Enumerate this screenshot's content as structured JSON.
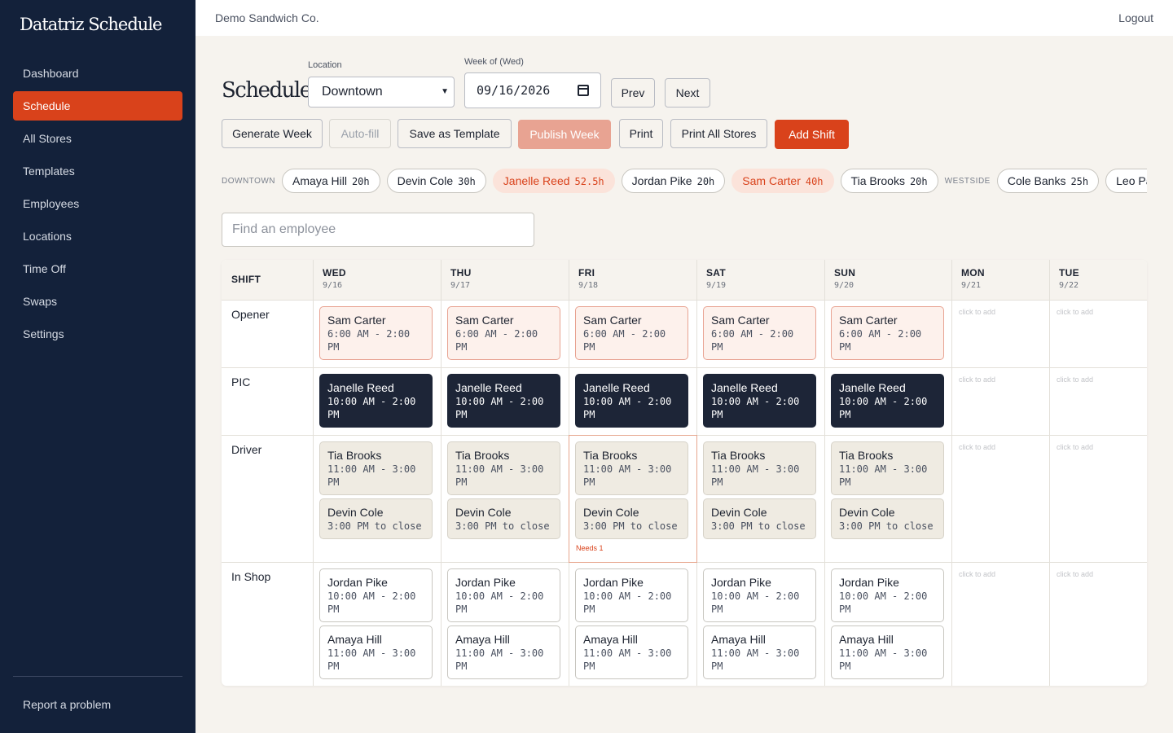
{
  "app": {
    "brand": "Datatriz Schedule",
    "company": "Demo Sandwich Co.",
    "logout": "Logout"
  },
  "sidebar": {
    "items": [
      {
        "label": "Dashboard",
        "active": false
      },
      {
        "label": "Schedule",
        "active": true
      },
      {
        "label": "All Stores",
        "active": false
      },
      {
        "label": "Templates",
        "active": false
      },
      {
        "label": "Employees",
        "active": false
      },
      {
        "label": "Locations",
        "active": false
      },
      {
        "label": "Time Off",
        "active": false
      },
      {
        "label": "Swaps",
        "active": false
      },
      {
        "label": "Settings",
        "active": false
      }
    ],
    "report": "Report a problem"
  },
  "controls": {
    "title": "Schedule",
    "location_label": "Location",
    "location_value": "Downtown",
    "week_label": "Week of (Wed)",
    "week_value": "09/16/2026",
    "prev": "Prev",
    "next": "Next",
    "buttons": {
      "generate": "Generate Week",
      "autofill": "Auto-fill",
      "save_template": "Save as Template",
      "publish": "Publish Week",
      "print": "Print",
      "print_all": "Print All Stores",
      "add_shift": "Add Shift"
    }
  },
  "hours": [
    {
      "group": "DOWNTOWN",
      "chips": [
        {
          "name": "Amaya Hill",
          "hours": "20h",
          "over": false
        },
        {
          "name": "Devin Cole",
          "hours": "30h",
          "over": false
        },
        {
          "name": "Janelle Reed",
          "hours": "52.5h",
          "over": true
        },
        {
          "name": "Jordan Pike",
          "hours": "20h",
          "over": false
        },
        {
          "name": "Sam Carter",
          "hours": "40h",
          "over": true
        },
        {
          "name": "Tia Brooks",
          "hours": "20h",
          "over": false
        }
      ]
    },
    {
      "group": "WESTSIDE",
      "chips": [
        {
          "name": "Cole Banks",
          "hours": "25h",
          "over": false
        },
        {
          "name": "Leo Par",
          "hours": "",
          "over": false
        }
      ]
    }
  ],
  "search_placeholder": "Find an employee",
  "grid": {
    "shift_header": "SHIFT",
    "days": [
      {
        "day": "WED",
        "date": "9/16"
      },
      {
        "day": "THU",
        "date": "9/17"
      },
      {
        "day": "FRI",
        "date": "9/18"
      },
      {
        "day": "SAT",
        "date": "9/19"
      },
      {
        "day": "SUN",
        "date": "9/20"
      },
      {
        "day": "MON",
        "date": "9/21"
      },
      {
        "day": "TUE",
        "date": "9/22"
      }
    ],
    "roles": [
      "Opener",
      "PIC",
      "Driver",
      "In Shop"
    ],
    "click_to_add": "click to add",
    "needs_label": "Needs 1",
    "shifts": {
      "opener": {
        "name": "Sam Carter",
        "time": "6:00 AM - 2:00 PM"
      },
      "pic": {
        "name": "Janelle Reed",
        "time": "10:00 AM - 2:00 PM"
      },
      "driver1": {
        "name": "Tia Brooks",
        "time": "11:00 AM - 3:00 PM"
      },
      "driver2": {
        "name": "Devin Cole",
        "time": "3:00 PM to close"
      },
      "shop1": {
        "name": "Jordan Pike",
        "time": "10:00 AM - 2:00 PM"
      },
      "shop2": {
        "name": "Amaya Hill",
        "time": "11:00 AM - 3:00 PM"
      }
    }
  }
}
